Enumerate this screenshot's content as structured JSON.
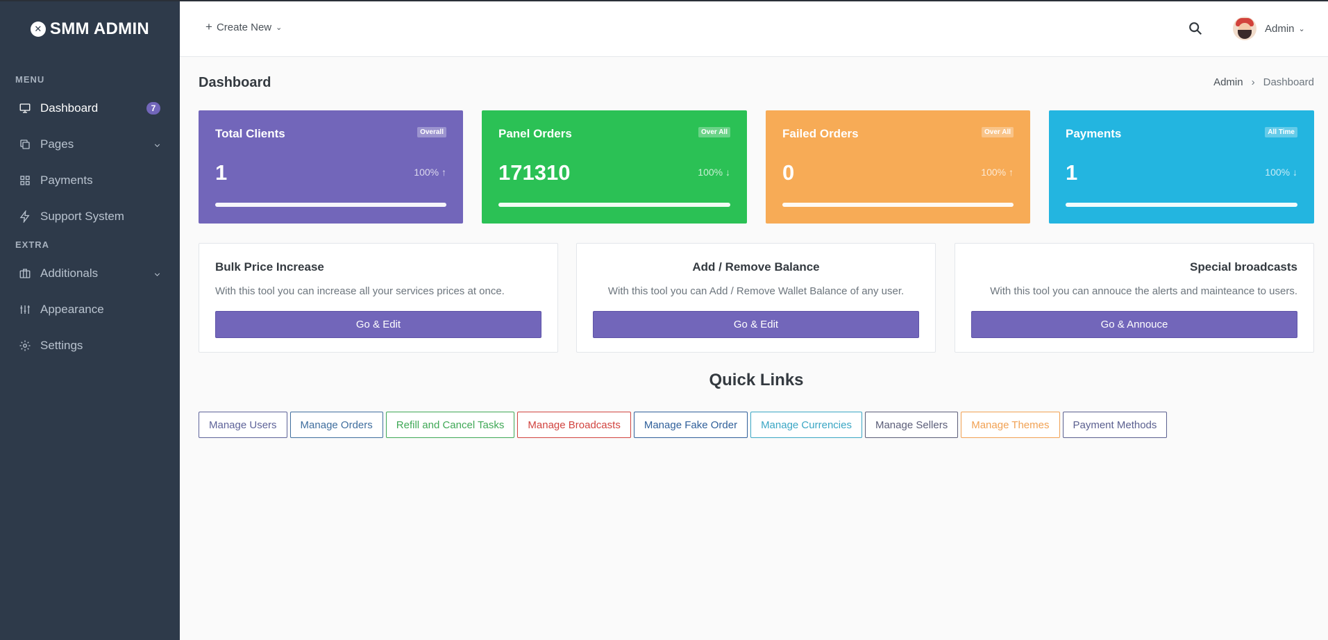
{
  "brand": {
    "name": "SMM ADMIN"
  },
  "sidebar": {
    "sections": [
      {
        "title": "MENU"
      },
      {
        "title": "EXTRA"
      }
    ],
    "items": [
      {
        "label": "Dashboard",
        "icon": "monitor-icon",
        "badge": "7",
        "active": true
      },
      {
        "label": "Pages",
        "icon": "copy-icon",
        "has_submenu": true
      },
      {
        "label": "Payments",
        "icon": "grid-icon"
      },
      {
        "label": "Support System",
        "icon": "zap-icon"
      },
      {
        "label": "Additionals",
        "icon": "briefcase-icon",
        "has_submenu": true
      },
      {
        "label": "Appearance",
        "icon": "sliders-icon"
      },
      {
        "label": "Settings",
        "icon": "gear-icon"
      }
    ]
  },
  "topbar": {
    "create_new": "Create New",
    "user_name": "Admin"
  },
  "page": {
    "title": "Dashboard",
    "breadcrumb": [
      "Admin",
      "Dashboard"
    ]
  },
  "stats": [
    {
      "title": "Total Clients",
      "tag": "Overall",
      "value": "1",
      "pct": "100%",
      "trend": "up",
      "color": "#7266ba",
      "progress": 1.0
    },
    {
      "title": "Panel Orders",
      "tag": "Over All",
      "value": "171310",
      "pct": "100%",
      "trend": "down",
      "color": "#2bc155",
      "progress": 1.0
    },
    {
      "title": "Failed Orders",
      "tag": "Over All",
      "value": "0",
      "pct": "100%",
      "trend": "up",
      "color": "#f7ab56",
      "progress": 1.0
    },
    {
      "title": "Payments",
      "tag": "All Time",
      "value": "1",
      "pct": "100%",
      "trend": "down",
      "color": "#23b5e0",
      "progress": 1.0
    }
  ],
  "tools": [
    {
      "title": "Bulk Price Increase",
      "desc": "With this tool you can increase all your services prices at once.",
      "button": "Go & Edit"
    },
    {
      "title": "Add / Remove Balance",
      "desc": "With this tool you can Add / Remove Wallet Balance of any user.",
      "button": "Go & Edit"
    },
    {
      "title": "Special broadcasts",
      "desc": "With this tool you can annouce the alerts and mainteance to users.",
      "button": "Go & Annouce"
    }
  ],
  "quick_links": {
    "title": "Quick Links",
    "items": [
      {
        "label": "Manage Users",
        "color": "#5e6399"
      },
      {
        "label": "Manage Orders",
        "color": "#3f6e9e"
      },
      {
        "label": "Refill and Cancel Tasks",
        "color": "#3fa856"
      },
      {
        "label": "Manage Broadcasts",
        "color": "#d1433f"
      },
      {
        "label": "Manage Fake Order",
        "color": "#2f5f9a"
      },
      {
        "label": "Manage Currencies",
        "color": "#3aa6c4"
      },
      {
        "label": "Manage Sellers",
        "color": "#5b5d78"
      },
      {
        "label": "Manage Themes",
        "color": "#f1a153"
      },
      {
        "label": "Payment Methods",
        "color": "#5a5f8f"
      }
    ]
  }
}
